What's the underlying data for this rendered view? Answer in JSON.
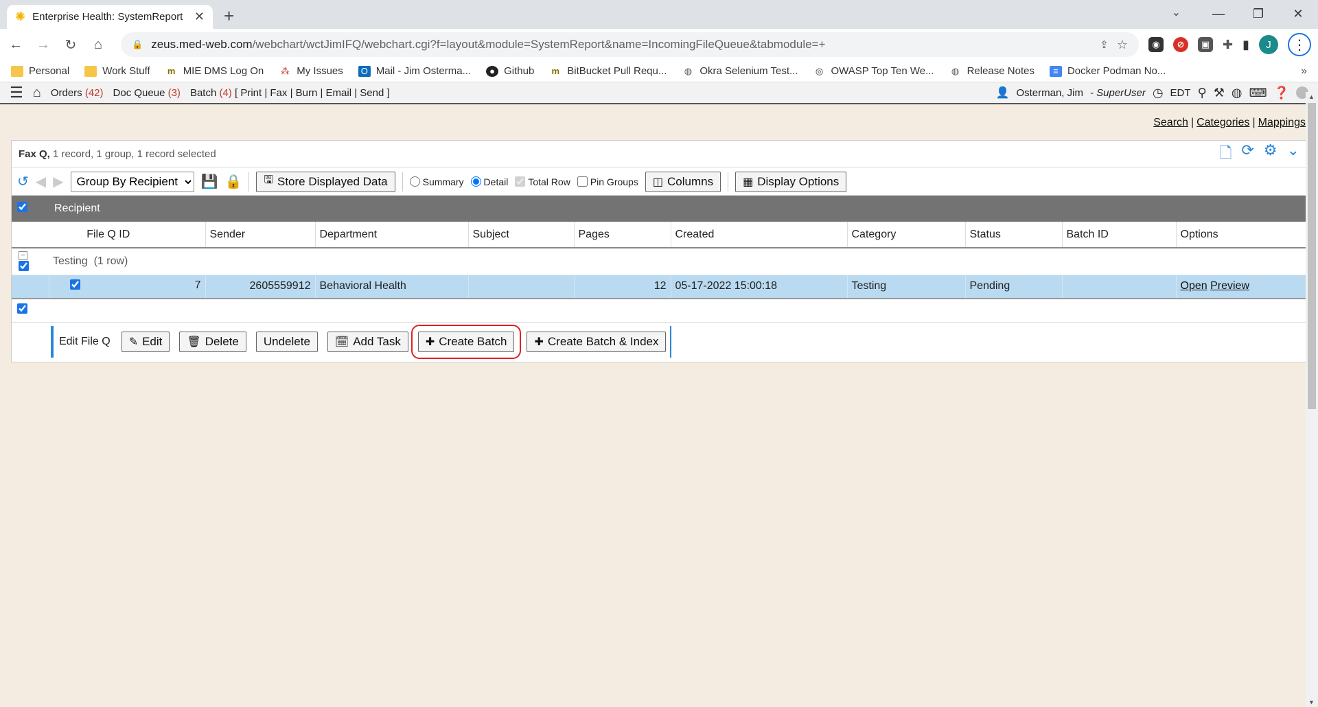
{
  "browser": {
    "tab_title": "Enterprise Health: SystemReport",
    "url_host": "zeus.med-web.com",
    "url_path": "/webchart/wctJimIFQ/webchart.cgi?f=layout&module=SystemReport&name=IncomingFileQueue&tabmodule=+",
    "profile_initial": "J",
    "bookmarks": [
      {
        "label": "Personal",
        "icon": "folder-icon"
      },
      {
        "label": "Work Stuff",
        "icon": "folder-icon"
      },
      {
        "label": "MIE DMS Log On",
        "icon": "mie-icon"
      },
      {
        "label": "My Issues",
        "icon": "issues-icon"
      },
      {
        "label": "Mail - Jim Osterma...",
        "icon": "outlook-icon"
      },
      {
        "label": "Github",
        "icon": "github-icon"
      },
      {
        "label": "BitBucket Pull Requ...",
        "icon": "mie-icon"
      },
      {
        "label": "Okra Selenium Test...",
        "icon": "globe-icon"
      },
      {
        "label": "OWASP Top Ten We...",
        "icon": "owasp-icon"
      },
      {
        "label": "Release Notes",
        "icon": "globe-icon"
      },
      {
        "label": "Docker Podman No...",
        "icon": "doc-icon"
      }
    ]
  },
  "header": {
    "orders_label": "Orders",
    "orders_count": "(42)",
    "docqueue_label": "Doc Queue",
    "docqueue_count": "(3)",
    "batch_label": "Batch",
    "batch_count": "(4)",
    "actions": "[ Print | Fax | Burn | Email | Send ]",
    "user": "Osterman, Jim",
    "role": "- SuperUser",
    "timezone": "EDT"
  },
  "top_links": {
    "search": "Search",
    "categories": "Categories",
    "mappings": "Mappings",
    "sep": "|"
  },
  "panel": {
    "title": "Fax Q,",
    "summary": "1 record, 1 group, 1 record selected"
  },
  "toolbar": {
    "group_by": "Group By Recipient",
    "store_label": "Store Displayed Data",
    "summary_label": "Summary",
    "detail_label": "Detail",
    "total_row_label": "Total Row",
    "pin_groups_label": "Pin Groups",
    "columns_label": "Columns",
    "display_options_label": "Display Options"
  },
  "grid": {
    "group_header": "Recipient",
    "columns": [
      "File Q ID",
      "Sender",
      "Department",
      "Subject",
      "Pages",
      "Created",
      "Category",
      "Status",
      "Batch ID",
      "Options"
    ],
    "group_name": "Testing",
    "group_count": "(1 row)",
    "rows": [
      {
        "file_q_id": "7",
        "sender": "2605559912",
        "department": "Behavioral Health",
        "subject": "",
        "pages": "12",
        "created": "05-17-2022 15:00:18",
        "category": "Testing",
        "status": "Pending",
        "batch_id": "",
        "open": "Open",
        "preview": "Preview"
      }
    ]
  },
  "actions": {
    "label": "Edit File Q",
    "edit": "Edit",
    "delete": "Delete",
    "undelete": "Undelete",
    "add_task": "Add Task",
    "create_batch": "Create Batch",
    "create_batch_index": "Create Batch & Index"
  },
  "colors": {
    "accent": "#2a87d8",
    "selected_row": "#b9daf0",
    "group_header": "#737373",
    "highlight": "#e02020",
    "count_red": "#c0392b"
  }
}
